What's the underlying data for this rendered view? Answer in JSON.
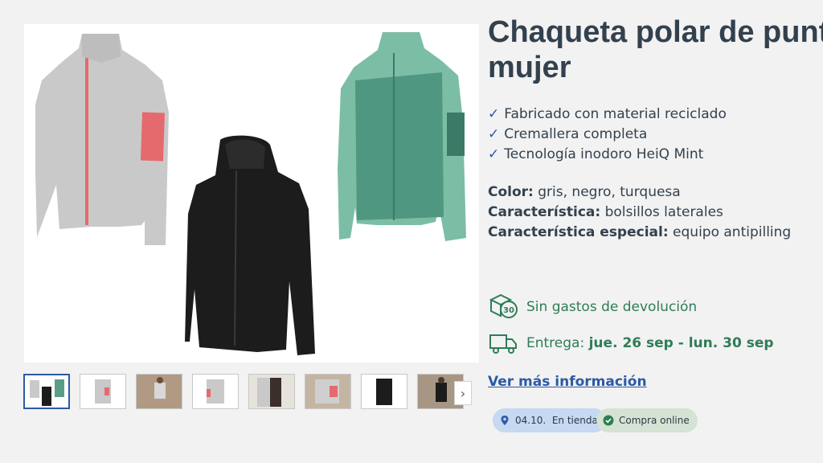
{
  "product": {
    "title": "Chaqueta polar de punto mujer",
    "features": [
      "Fabricado con material reciclado",
      "Cremallera completa",
      "Tecnología inodoro HeiQ Mint"
    ],
    "specs": [
      {
        "label": "Color:",
        "value": "gris, negro, turquesa"
      },
      {
        "label": "Característica:",
        "value": "bolsillos laterales"
      },
      {
        "label": "Característica especial:",
        "value": "equipo antipilling"
      }
    ]
  },
  "gallery": {
    "jacket_colors": {
      "grey": "#c9c9c9",
      "black": "#1c1c1c",
      "turquoise": "#5a9e86",
      "accent": "#e46a6e"
    },
    "thumbnails": [
      {
        "name": "thumbnail-all-colors",
        "active": true
      },
      {
        "name": "thumbnail-grey-jacket",
        "active": false
      },
      {
        "name": "thumbnail-model-photo-1",
        "active": false
      },
      {
        "name": "thumbnail-grey-jacket-back",
        "active": false
      },
      {
        "name": "thumbnail-detail-photo",
        "active": false
      },
      {
        "name": "thumbnail-sleeve-detail",
        "active": false
      },
      {
        "name": "thumbnail-black-jacket",
        "active": false
      },
      {
        "name": "thumbnail-model-photo-2",
        "active": false
      }
    ],
    "next_icon": "chevron-right-icon"
  },
  "services": {
    "returns": {
      "text": "Sin gastos de devolución",
      "icon": "return-box-30-icon"
    },
    "delivery": {
      "label": "Entrega:",
      "dates": "jue. 26 sep - lun. 30 sep",
      "icon": "delivery-truck-icon"
    }
  },
  "more_info": "Ver más información",
  "availability": {
    "store_date": "04.10.",
    "store_label": "En tienda",
    "online_label": "Compra online"
  },
  "colors": {
    "link": "#2b5aa6",
    "service_green": "#2e7d57",
    "text": "#33414e"
  }
}
